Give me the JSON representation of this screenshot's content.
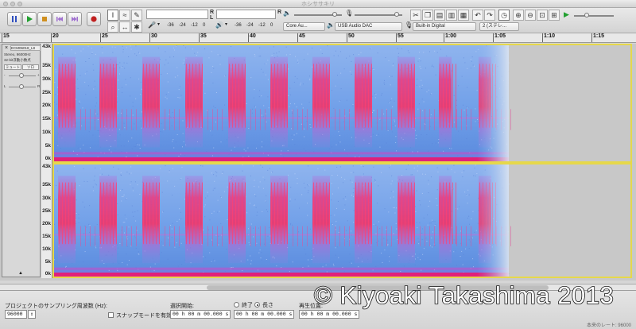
{
  "window": {
    "title": "ホシササキリ"
  },
  "transport": {
    "pause": "pause-icon",
    "play": "play-icon",
    "stop": "stop-icon",
    "skip_start": "skip-start-icon",
    "skip_end": "skip-end-icon",
    "record": "record-icon"
  },
  "meters": {
    "rec_label": "R",
    "play_label": "R",
    "left_label": "L",
    "rec_ticks": [
      "-36",
      "-24",
      "-12",
      "0"
    ],
    "play_ticks": [
      "-36",
      "-24",
      "-12",
      "0"
    ]
  },
  "devices": {
    "host": "Core Au...",
    "output": "USB Audio DAC",
    "input": "Built-in Digital",
    "channels": "2 (ステレ..."
  },
  "ruler": {
    "ticks": [
      "15",
      "20",
      "25",
      "30",
      "35",
      "40",
      "45",
      "50",
      "55",
      "1:00",
      "1:05",
      "1:10",
      "1:15"
    ]
  },
  "track": {
    "name": "ECM06018_L8",
    "info1": "Stereo, 96000Hz",
    "info2": "32-bit浮動小数点",
    "mute": "ミュート",
    "solo": "ソロ",
    "minus": "-",
    "plus": "+",
    "left": "L",
    "right": "R"
  },
  "freq_labels": [
    "43k",
    "35k",
    "30k",
    "25k",
    "20k",
    "15k",
    "10k",
    "5k",
    "0k"
  ],
  "selection_bar": {
    "rate_label": "プロジェクトのサンプリング周波数 (Hz):",
    "rate_value": "96000",
    "snap_label": "スナップモードを有効",
    "start_label": "選択開始:",
    "end_label": "終了",
    "length_label": "長さ",
    "position_label": "再生位置:",
    "time_value": "00 h 00 m 00.000 s",
    "status": "本来のレート: 96000"
  },
  "watermark": "© Kiyoaki Takashima 2013"
}
